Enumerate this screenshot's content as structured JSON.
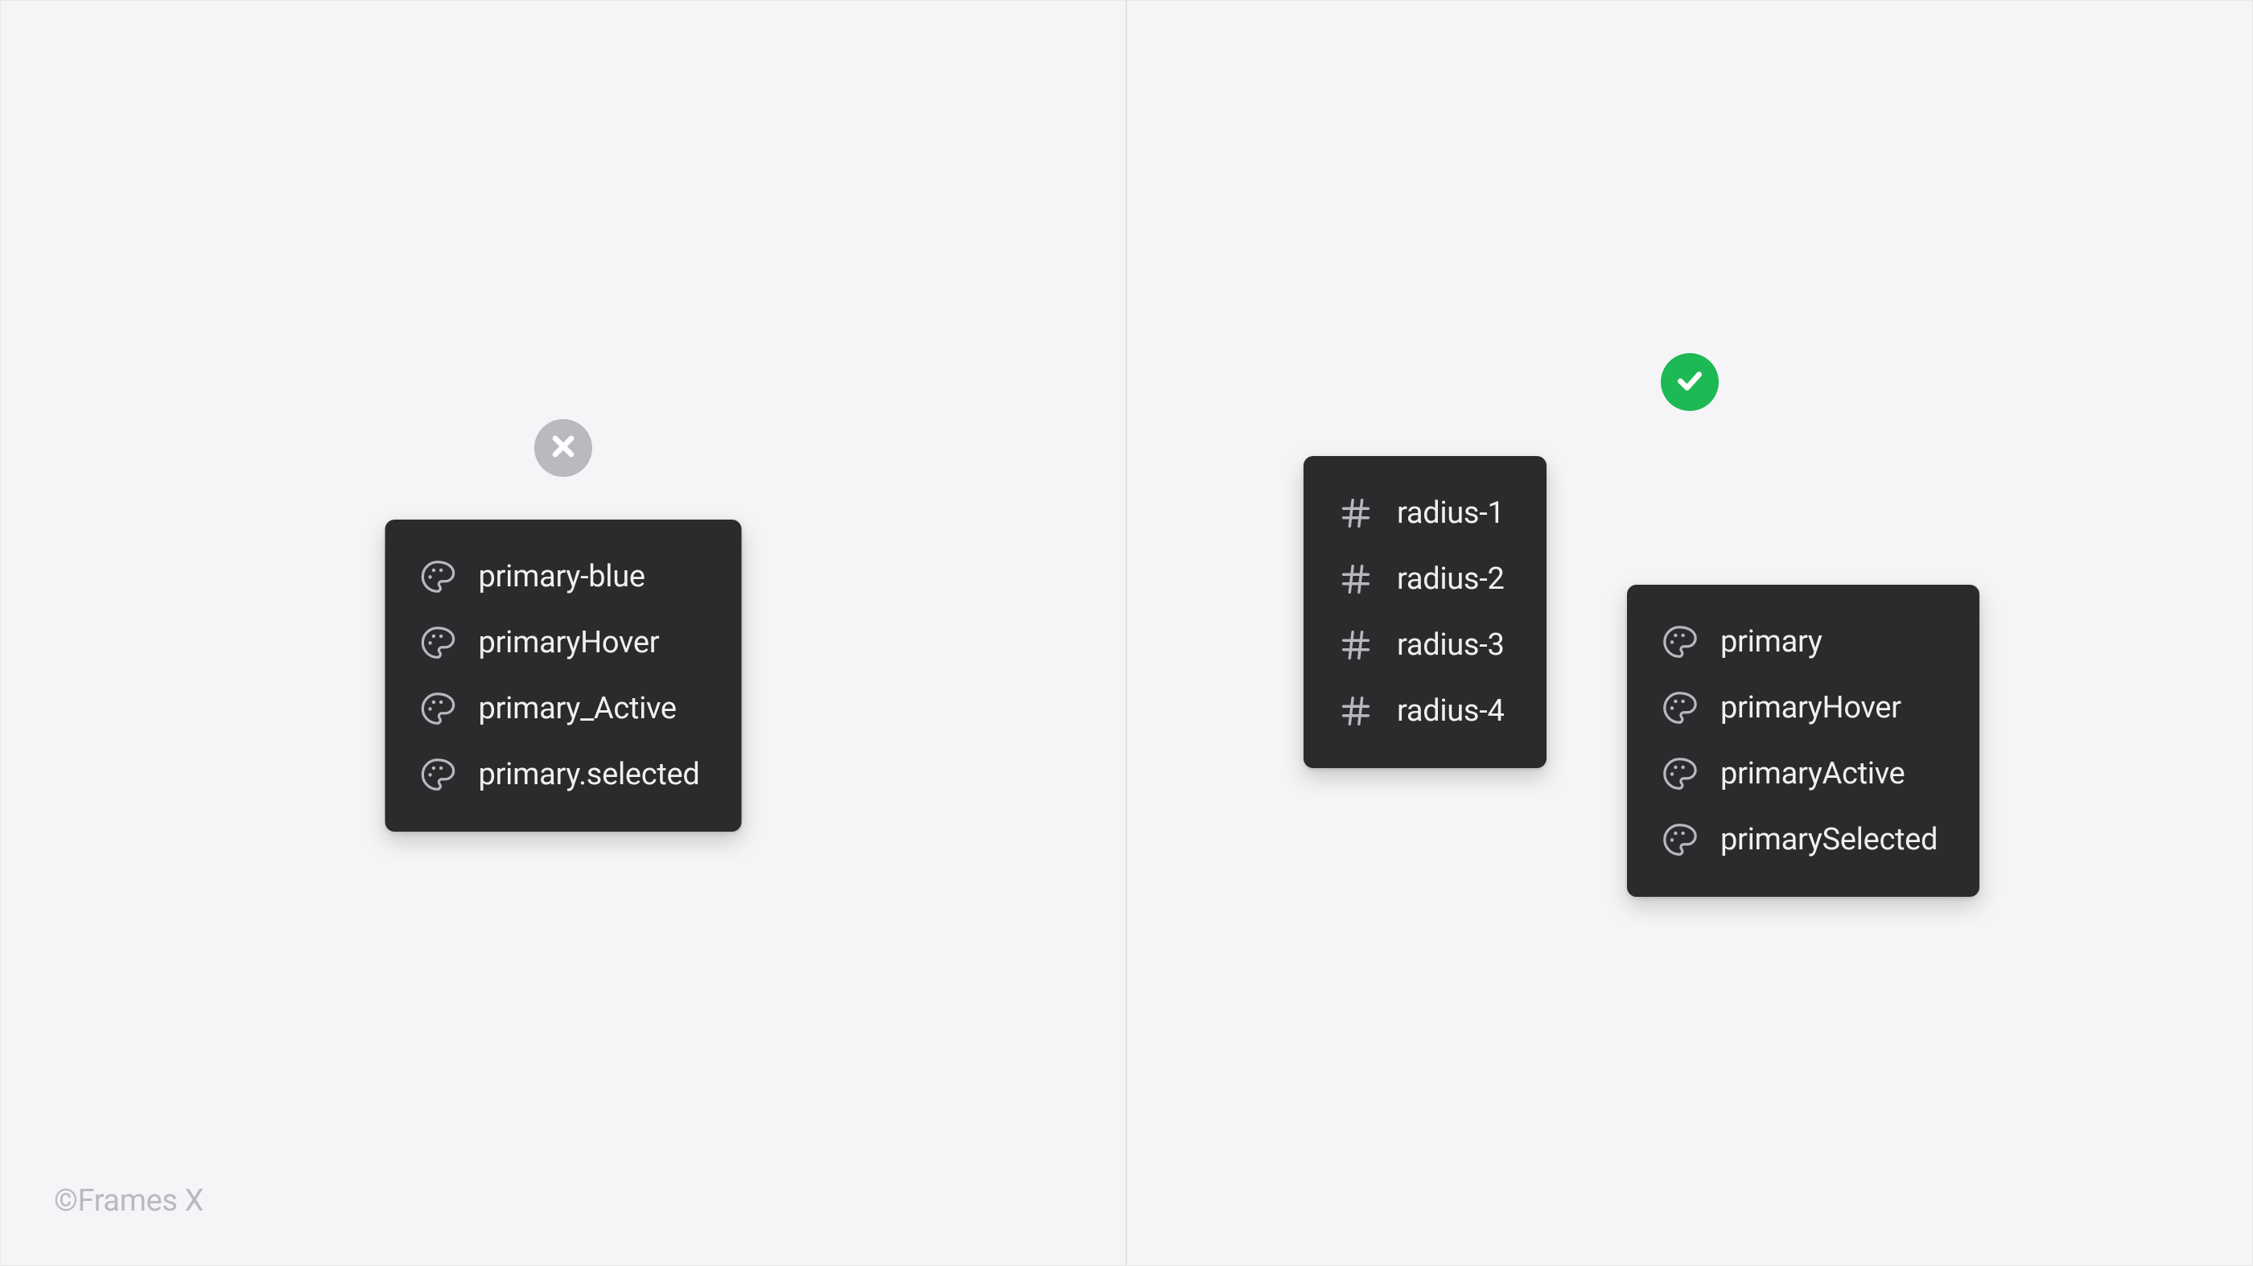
{
  "left": {
    "status": "incorrect",
    "items": [
      {
        "label": "primary-blue",
        "icon": "palette"
      },
      {
        "label": "primaryHover",
        "icon": "palette"
      },
      {
        "label": "primary_Active",
        "icon": "palette"
      },
      {
        "label": "primary.selected",
        "icon": "palette"
      }
    ]
  },
  "right": {
    "status": "correct",
    "radiusItems": [
      {
        "label": "radius-1",
        "icon": "hash"
      },
      {
        "label": "radius-2",
        "icon": "hash"
      },
      {
        "label": "radius-3",
        "icon": "hash"
      },
      {
        "label": "radius-4",
        "icon": "hash"
      }
    ],
    "primaryItems": [
      {
        "label": "primary",
        "icon": "palette"
      },
      {
        "label": "primaryHover",
        "icon": "palette"
      },
      {
        "label": "primaryActive",
        "icon": "palette"
      },
      {
        "label": "primarySelected",
        "icon": "palette"
      }
    ]
  },
  "footer": {
    "credit": "©Frames X"
  },
  "colors": {
    "panelBg": "#2b2b2d",
    "pageBg": "#f5f5f7",
    "successBadge": "#1db954",
    "errorBadge": "#b9b9bf",
    "itemText": "#f0f0f2",
    "iconStroke": "#b8b8bc"
  }
}
